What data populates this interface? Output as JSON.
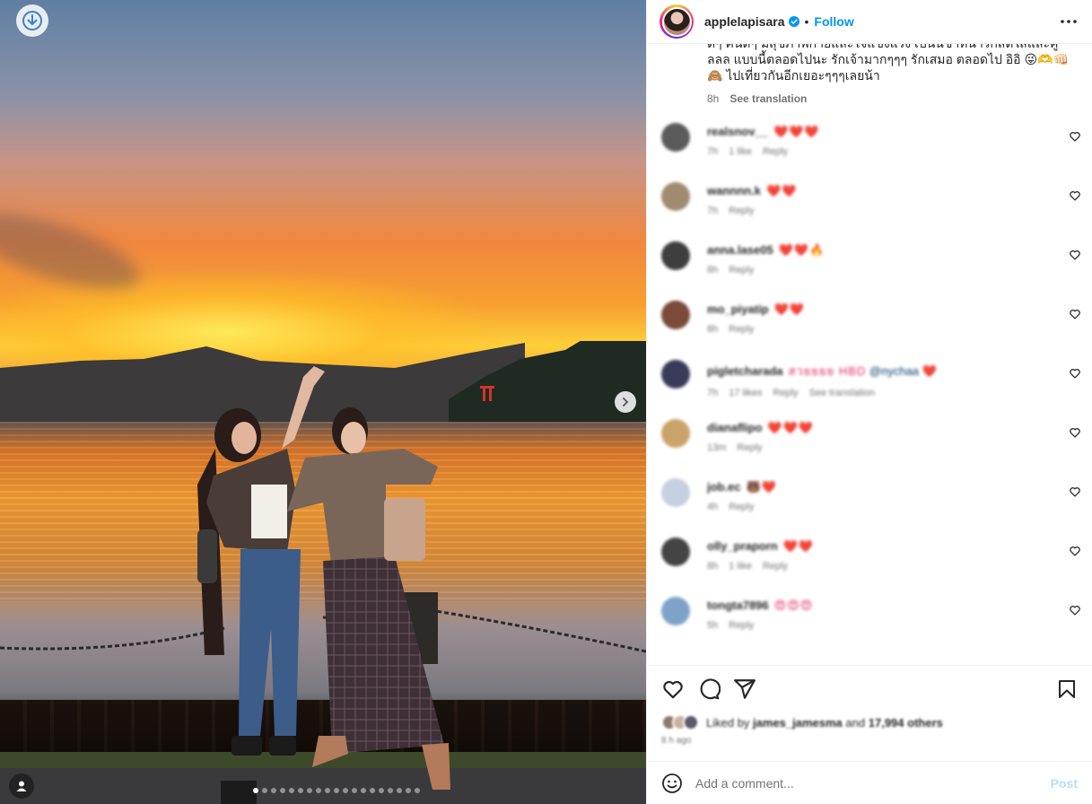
{
  "post": {
    "username": "applelapisara",
    "follow_label": "Follow",
    "separator": "•",
    "caption": "ดๆ คนดๆ มสุขภาพกายและใจแขงแรง เปนนชาทนารกสดใสและคูลลล แบบนี้ตลอดไปนะ รักเจ้ามากๆๆๆ รักเสมอ ตลอดไป อิอิ 😜🫶👊🏻🙈 ไปเที่ยวกันอีกเยอะๆๆๆเลยน้า",
    "caption_time": "8h",
    "see_translation": "See translation",
    "carousel_dots": 19,
    "carousel_active": 0
  },
  "comments": [
    {
      "user": "realsnov__",
      "text": "❤️❤️❤️",
      "time": "7h",
      "likes": "1 like",
      "reply": "Reply",
      "avatar": "#5b5b5b"
    },
    {
      "user": "wannnn.k",
      "text": "❤️❤️",
      "time": "7h",
      "likes": "",
      "reply": "Reply",
      "avatar": "#a08a70"
    },
    {
      "user": "anna.lase05",
      "text": "❤️❤️🔥",
      "time": "8h",
      "likes": "",
      "reply": "Reply",
      "avatar": "#3e3e3e"
    },
    {
      "user": "mo_piyatip",
      "text": "❤️❤️",
      "time": "8h",
      "likes": "",
      "reply": "Reply",
      "avatar": "#7a4a3a"
    },
    {
      "user": "pigletcharada",
      "text": "สวยยยย HBD",
      "mention": "@nychaa",
      "text2": "❤️",
      "time": "7h",
      "likes": "17 likes",
      "reply": "Reply",
      "extra": "See translation",
      "avatar": "#3a3a5a"
    },
    {
      "user": "dianaflipo",
      "text": "❤️❤️❤️",
      "time": "13m",
      "likes": "",
      "reply": "Reply",
      "avatar": "#c9a36a"
    },
    {
      "user": "job.ec",
      "text": "🐻❤️",
      "time": "4h",
      "likes": "",
      "reply": "Reply",
      "avatar": "#c6d0e0"
    },
    {
      "user": "olly_praporn",
      "text": "❤️❤️",
      "time": "8h",
      "likes": "1 like",
      "reply": "Reply",
      "avatar": "#444"
    },
    {
      "user": "tongta7896",
      "text": "😍😍😍",
      "time": "5h",
      "likes": "",
      "reply": "Reply",
      "avatar": "#7fa2c9"
    }
  ],
  "likes_line": {
    "prefix": "Liked by",
    "user": "james_jamesma",
    "middle": "and",
    "others": "17,994 others"
  },
  "time_ago": "8 h ago",
  "add_comment": {
    "placeholder": "Add a comment...",
    "post_label": "Post"
  },
  "icons": {
    "download": "download-icon",
    "next": "chevron-right-icon",
    "user_tag": "user-tag-icon",
    "verified": "verified-badge-icon",
    "more": "more-icon",
    "like": "heart-icon",
    "comment": "comment-icon",
    "share": "share-icon",
    "save": "bookmark-icon",
    "emoji": "emoji-icon"
  },
  "colors": {
    "accent": "#0095f6",
    "heart": "#e0245e",
    "muted": "#737373",
    "post_disabled": "#b2dffc"
  }
}
